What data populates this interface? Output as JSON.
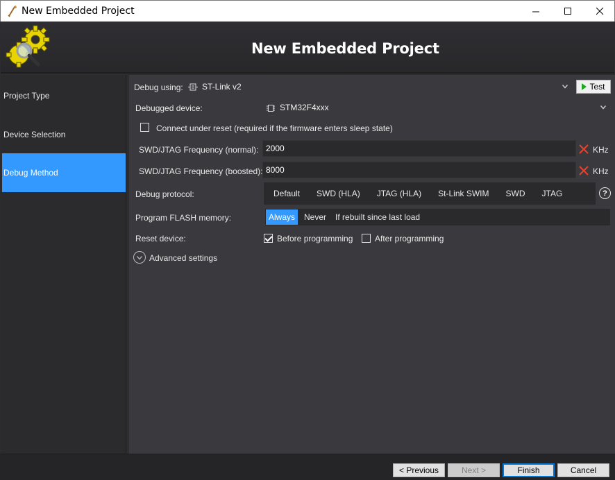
{
  "window": {
    "title": "New Embedded Project"
  },
  "header": {
    "heading": "New Embedded Project"
  },
  "sidebar": {
    "items": [
      {
        "label": "Project Type",
        "active": false
      },
      {
        "label": "Device Selection",
        "active": false
      },
      {
        "label": "Debug Method",
        "active": true
      }
    ]
  },
  "debug_using": {
    "label": "Debug using:",
    "value": "ST-Link v2",
    "test_label": "Test"
  },
  "debugged_device": {
    "label": "Debugged device:",
    "value": "STM32F4xxx"
  },
  "connect_under_reset": {
    "label": "Connect under reset (required if the firmware enters sleep state)",
    "checked": false
  },
  "freq_normal": {
    "label": "SWD/JTAG Frequency (normal):",
    "value": "2000",
    "unit": "KHz"
  },
  "freq_boosted": {
    "label": "SWD/JTAG Frequency (boosted):",
    "value": "8000",
    "unit": "KHz"
  },
  "debug_protocol": {
    "label": "Debug protocol:",
    "options": [
      "Default",
      "SWD (HLA)",
      "JTAG (HLA)",
      "St-Link SWIM",
      "SWD",
      "JTAG"
    ],
    "help": "?"
  },
  "program_flash": {
    "label": "Program FLASH memory:",
    "options": [
      "Always",
      "Never",
      "If rebuilt since last load"
    ],
    "selected": "Always"
  },
  "reset_device": {
    "label": "Reset device:",
    "before_label": "Before programming",
    "before_checked": true,
    "after_label": "After programming",
    "after_checked": false
  },
  "advanced": {
    "label": "Advanced settings"
  },
  "footer": {
    "previous": "< Previous",
    "next": "Next >",
    "finish": "Finish",
    "cancel": "Cancel"
  },
  "colors": {
    "accent": "#3399ff",
    "background": "#2d2d30",
    "panel": "#3a3a3e",
    "error_x": "#e8412c",
    "test_play": "#1ca81c"
  }
}
